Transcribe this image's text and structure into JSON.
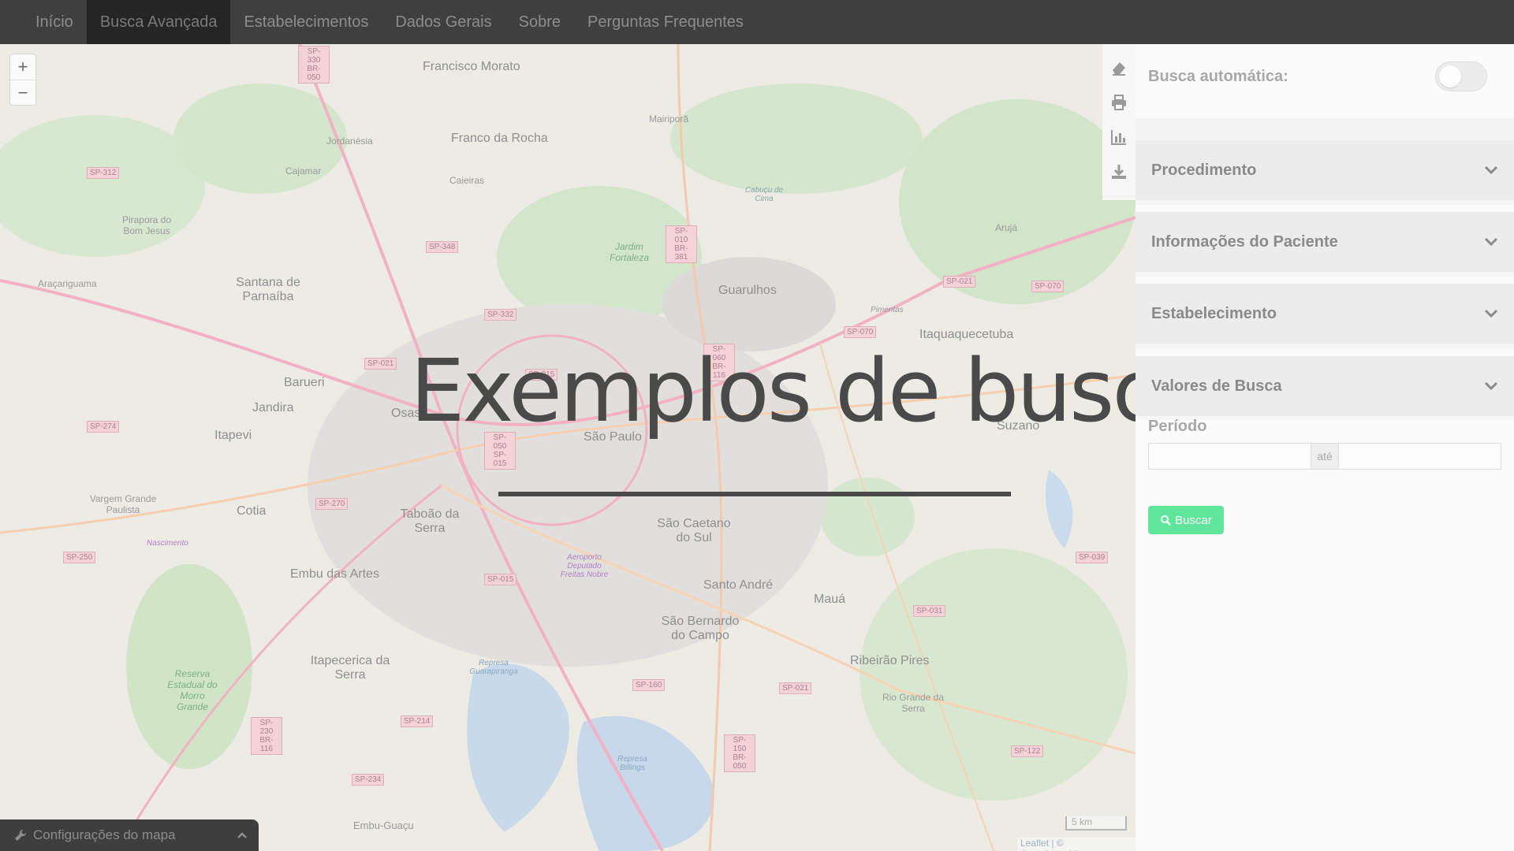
{
  "nav": {
    "items": [
      "Início",
      "Busca Avançada",
      "Estabelecimentos",
      "Dados Gerais",
      "Sobre",
      "Perguntas Frequentes"
    ]
  },
  "map": {
    "zoom_in": "+",
    "zoom_out": "−",
    "scale_label": "5 km",
    "attribution": "Leaflet | © OpenStreetMap",
    "config_label": "Configurações do mapa",
    "labels": {
      "francisco_morato": "Francisco Morato",
      "franco_da_rocha": "Franco da Rocha",
      "mairipora": "Mairiporã",
      "jordanesia": "Jordanésia",
      "cajamar": "Cajamar",
      "caieiras": "Caieiras",
      "pirapora": "Pirapora do Bom Jesus",
      "santana": "Santana de Parnaíba",
      "aracariguama": "Araçariguama",
      "guarulhos": "Guarulhos",
      "aruja": "Arujá",
      "itaquaquecetuba": "Itaquaquecetuba",
      "barueri": "Barueri",
      "jandira": "Jandira",
      "itapevi": "Itapevi",
      "osasco": "Osas",
      "sao_paulo": "São Paulo",
      "suzano": "Suzano",
      "vargem": "Vargem Grande Paulista",
      "cotia": "Cotia",
      "taboao": "Taboão da Serra",
      "embu": "Embu das Artes",
      "sao_caetano": "São Caetano do Sul",
      "santo_andre": "Santo André",
      "maua": "Mauá",
      "sao_bernardo": "São Bernardo do Campo",
      "itapecerica": "Itapecerica da Serra",
      "ribeirao_pires": "Ribeirão Pires",
      "rio_grande": "Rio Grande da Serra",
      "embu_guacu": "Embu-Guaçu",
      "reserva": "Reserva Estadual do Morro Grande",
      "jardim": "Jardim Fortaleza",
      "cabucu": "Cabuçu de Cima",
      "pimentas": "Pimentas",
      "nascimento": "Nascimento",
      "aeroporto": "Aeroporto Deputado Freitas Nobre",
      "represa_guarapiranga": "Represa Guarapiranga",
      "represa_billings": "Represa Billings"
    },
    "shields": [
      "SP-330 BR-050",
      "SP-312",
      "SP-348",
      "SP-332",
      "SP-010 BR-381",
      "SP-021",
      "SP-070",
      "SP-015",
      "SP-060 BR-116",
      "SP-070",
      "SP-274",
      "SP-050 SP-015",
      "SP-270",
      "SP-250",
      "SP-015",
      "SP-039",
      "SP-031",
      "SP-160",
      "SP-021",
      "SP-230 BR-116",
      "SP-214",
      "SP-150 BR-050",
      "SP-122",
      "SP-234",
      "SP-021"
    ]
  },
  "overlay": {
    "title": "Exemplos de busca"
  },
  "sidebar": {
    "auto_search_label": "Busca automática:",
    "auto_search_on": false,
    "sections": [
      "Procedimento",
      "Informações do Paciente",
      "Estabelecimento",
      "Valores de Busca"
    ],
    "period_label": "Período",
    "period_separator": "até",
    "period_start": "",
    "period_end": "",
    "search_button": "Buscar"
  },
  "colors": {
    "navbar": "#3f3f3f",
    "nav_active": "#252525",
    "accent_green": "#5fe69a"
  }
}
